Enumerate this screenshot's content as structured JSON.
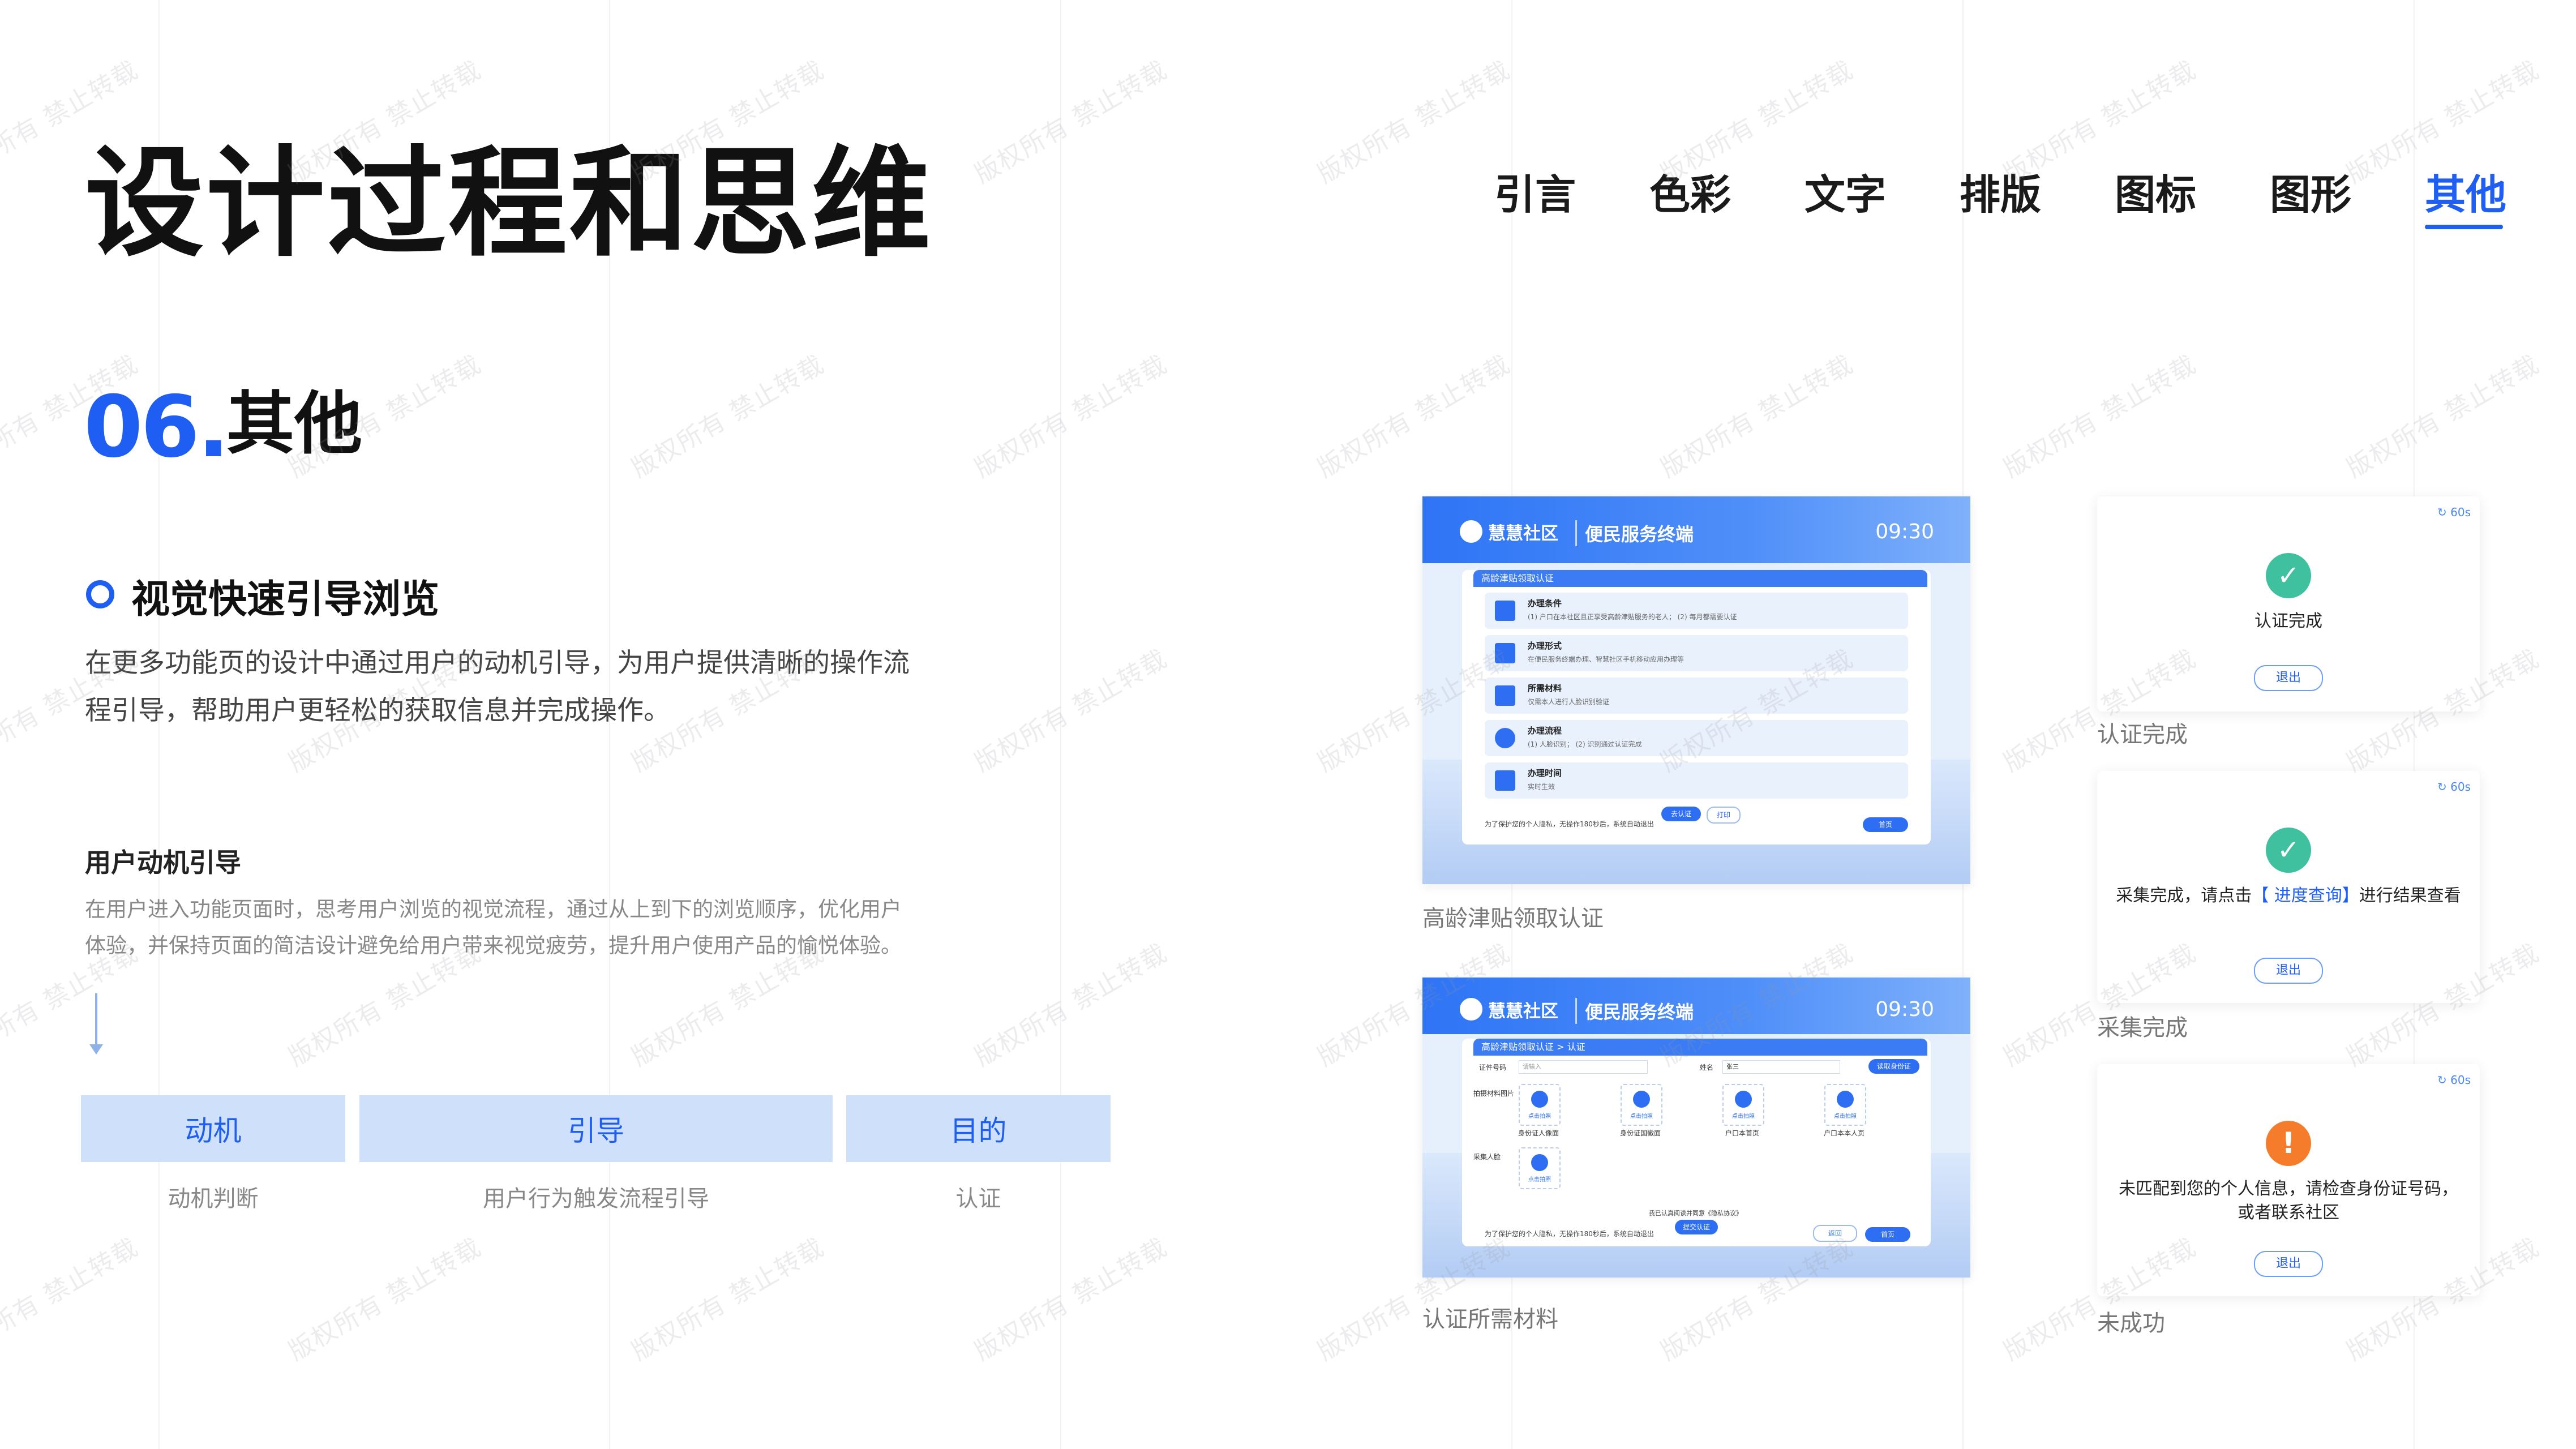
{
  "page": {
    "title": "设计过程和思维",
    "section_number": "06.",
    "section_name": "其他",
    "watermark": "版权所有 禁止转载"
  },
  "nav": {
    "items": [
      "引言",
      "色彩",
      "文字",
      "排版",
      "图标",
      "图形",
      "其他"
    ],
    "active": "其他"
  },
  "content": {
    "subheading": "视觉快速引导浏览",
    "intro_line1": "在更多功能页的设计中通过用户的动机引导，为用户提供清晰的操作流",
    "intro_line2": "程引导，帮助用户更轻松的获取信息并完成操作。",
    "label": "用户动机引导",
    "desc_line1": "在用户进入功能页面时，思考用户浏览的视觉流程，通过从上到下的浏览顺序，优化用户",
    "desc_line2": "体验，并保持页面的简洁设计避免给用户带来视觉疲劳，提升用户使用产品的愉悦体验。"
  },
  "flow": [
    {
      "label": "动机",
      "caption": "动机判断"
    },
    {
      "label": "引导",
      "caption": "用户行为触发流程引导"
    },
    {
      "label": "目的",
      "caption": "认证"
    }
  ],
  "screens": {
    "brand": "慧慧社区",
    "terminal": "便民服务终端",
    "time": "09:30",
    "screen1": {
      "caption": "高龄津贴领取认证",
      "crumb": "高龄津贴领取认证",
      "rows": [
        {
          "title": "办理条件",
          "desc": "(1) 户口在本社区且正享受高龄津贴服务的老人； (2) 每月都需要认证"
        },
        {
          "title": "办理形式",
          "desc": "在便民服务终端办理、智慧社区手机移动应用办理等"
        },
        {
          "title": "所需材料",
          "desc": "仅需本人进行人脸识别验证"
        },
        {
          "title": "办理流程",
          "desc": "(1) 人脸识别； (2) 识别通过认证完成"
        },
        {
          "title": "办理时间",
          "desc": "实时生效"
        }
      ],
      "btn_primary": "去认证",
      "btn_secondary": "打印",
      "footer": "为了保护您的个人隐私，无操作180秒后，系统自动退出",
      "home_btn": "首页"
    },
    "screen2": {
      "caption": "认证所需材料",
      "crumb": "高龄津贴领取认证 > 认证",
      "field1_label": "证件号码",
      "field1_placeholder": "请输入",
      "field2_label": "姓名",
      "field2_value": "张三",
      "top_btn": "读取身份证",
      "group1": "拍摄材料图片",
      "group2": "采集人脸",
      "uploads": [
        "身份证人像面",
        "身份证国徽面",
        "户口本首页",
        "户口本本人页"
      ],
      "upload_hint": "点击拍照",
      "agree": "我已认真阅读并同意《隐私协议》",
      "submit": "提交认证",
      "footer": "为了保护您的个人隐私，无操作180秒后，系统自动退出",
      "back_btn": "返回",
      "home_btn": "首页"
    }
  },
  "cards": [
    {
      "timer": "60s",
      "status": "ok",
      "message": "认证完成",
      "button": "退出",
      "caption": "认证完成"
    },
    {
      "timer": "60s",
      "status": "ok",
      "message_prefix": "采集完成，请点击",
      "message_link": "【 进度查询】",
      "message_suffix": "进行结果查看",
      "button": "退出",
      "caption": "采集完成"
    },
    {
      "timer": "60s",
      "status": "warn",
      "message": "未匹配到您的个人信息，请检查身份证号码，或者联系社区",
      "button": "退出",
      "caption": "未成功"
    }
  ],
  "colors": {
    "accent": "#1e5ef3",
    "flow_box": "#cfe0fb",
    "success": "#3fc1a0",
    "warning": "#f57c2a"
  }
}
